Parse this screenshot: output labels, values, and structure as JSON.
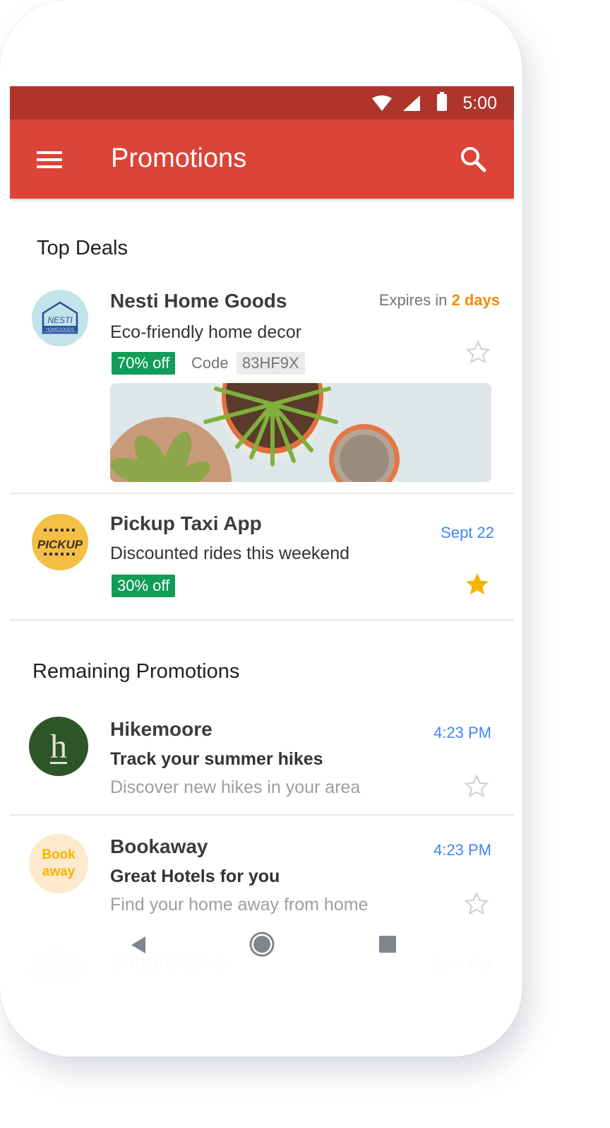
{
  "status_bar": {
    "time": "5:00",
    "icons": [
      "wifi-icon",
      "cell-signal-icon",
      "battery-icon"
    ]
  },
  "app_bar": {
    "title": "Promotions",
    "menu_icon": "hamburger-menu-icon",
    "search_icon": "search-icon"
  },
  "sections": {
    "top_deals": {
      "title": "Top Deals",
      "items": [
        {
          "sender": "Nesti Home Goods",
          "avatar_text": "NESTI",
          "avatar_subtext": "HOMEGOODS",
          "subject": "Eco-friendly home decor",
          "meta_prefix": "Expires in ",
          "meta_highlight": "2 days",
          "badge": "70% off",
          "code_label": "Code",
          "code_value": "83HF9X",
          "starred": false,
          "has_image": true
        },
        {
          "sender": "Pickup Taxi App",
          "avatar_text": "PICKUP",
          "subject": "Discounted rides this weekend",
          "date": "Sept 22",
          "badge": "30% off",
          "starred": true
        }
      ]
    },
    "remaining": {
      "title": "Remaining Promotions",
      "items": [
        {
          "sender": "Hikemoore",
          "avatar_text": "h",
          "subject": "Track your summer hikes",
          "snippet": "Discover new hikes in your area",
          "time": "4:23 PM",
          "starred": false
        },
        {
          "sender": "Bookaway",
          "avatar_text_1": "Book",
          "avatar_text_2": "away",
          "subject": "Great Hotels for you",
          "snippet": "Find your home away from home",
          "time": "4:23 PM",
          "starred": false
        },
        {
          "sender": "Simple Saver",
          "time": "3:44 PM"
        }
      ]
    }
  },
  "nav_bar": {
    "back": "back-icon",
    "home": "home-icon",
    "recents": "recents-icon"
  },
  "colors": {
    "app_bar": "#db4437",
    "status_bar": "#ae342c",
    "badge": "#0f9d58",
    "date_blue": "#4285f4",
    "expires_orange": "#f28b00",
    "star_yellow": "#f4b400"
  }
}
